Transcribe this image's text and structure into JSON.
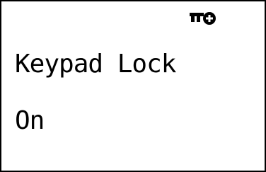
{
  "screen": {
    "title": "Keypad Lock",
    "value": "On",
    "icon": "key-icon",
    "colors": {
      "background": "#ffffff",
      "foreground": "#000000"
    }
  }
}
